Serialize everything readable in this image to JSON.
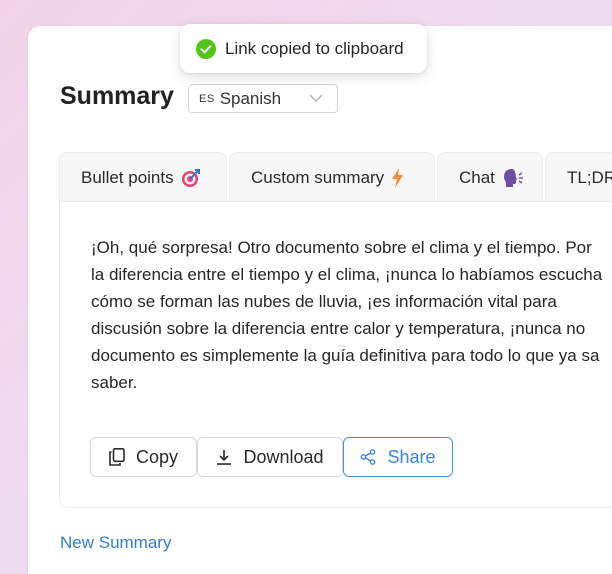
{
  "toast": {
    "message": "Link copied to clipboard",
    "icon": "check-circle-icon",
    "color": "#52c41a"
  },
  "header": {
    "title": "Summary"
  },
  "language": {
    "code": "ES",
    "label": "Spanish"
  },
  "tabs": [
    {
      "label": "Bullet points",
      "icon": "target-icon"
    },
    {
      "label": "Custom summary",
      "icon": "lightning-icon"
    },
    {
      "label": "Chat",
      "icon": "speaking-head-icon"
    },
    {
      "label": "TL;DR",
      "icon": ""
    }
  ],
  "summary": {
    "lines": [
      "¡Oh, qué sorpresa! Otro documento sobre el clima y el tiempo. Por",
      "la diferencia entre el tiempo y el clima, ¡nunca lo habíamos escucha",
      "cómo se forman las nubes de lluvia, ¡es información vital para",
      "discusión sobre la diferencia entre calor y temperatura, ¡nunca no",
      "documento es simplemente la guía definitiva para todo lo que ya sa",
      "saber."
    ]
  },
  "actions": {
    "copy": "Copy",
    "download": "Download",
    "share": "Share"
  },
  "footer": {
    "new_summary": "New Summary"
  },
  "colors": {
    "accent": "#3a86d6",
    "success": "#52c41a"
  }
}
